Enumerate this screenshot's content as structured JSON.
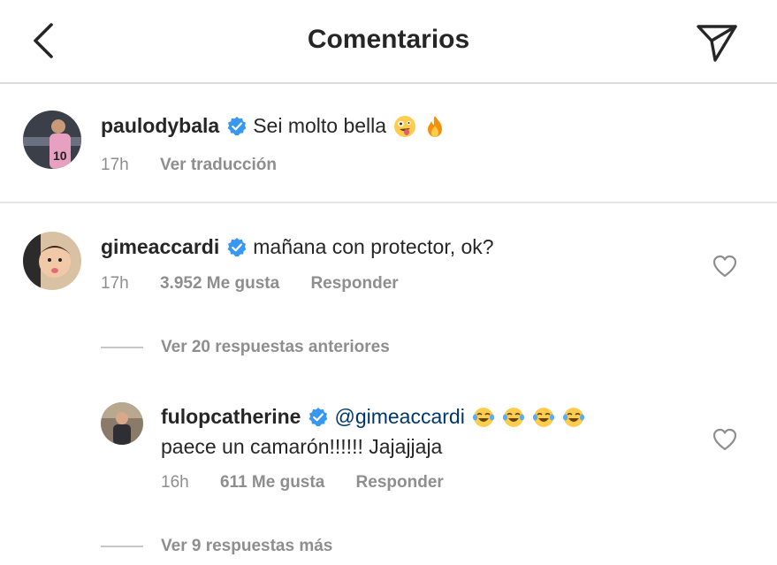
{
  "header": {
    "title": "Comentarios",
    "back_icon": "chevron-left-icon",
    "send_icon": "paper-plane-icon"
  },
  "comments": [
    {
      "username": "paulodybala",
      "verified": true,
      "text": "Sei molto bella",
      "emojis": [
        "zany-face-emoji",
        "fire-emoji"
      ],
      "time": "17h",
      "translate": "Ver traducción"
    },
    {
      "username": "gimeaccardi",
      "verified": true,
      "text": "mañana con protector, ok?",
      "time": "17h",
      "likes": "3.952 Me gusta",
      "reply": "Responder"
    }
  ],
  "view_previous": "Ver 20 respuestas anteriores",
  "reply": {
    "username": "fulopcatherine",
    "verified": true,
    "mention": "@gimeaccardi",
    "emojis": [
      "tears-of-joy-emoji",
      "tears-of-joy-emoji",
      "tears-of-joy-emoji",
      "tears-of-joy-emoji"
    ],
    "text": "paece un camarón!!!!!! Jajajjaja",
    "time": "16h",
    "likes": "611 Me gusta",
    "reply": "Responder"
  },
  "view_more": "Ver 9 respuestas más",
  "colors": {
    "text": "#262626",
    "muted": "#8e8e8e",
    "verified_blue": "#0095f6",
    "mention": "#00376b",
    "divider": "#dbdbdb"
  }
}
